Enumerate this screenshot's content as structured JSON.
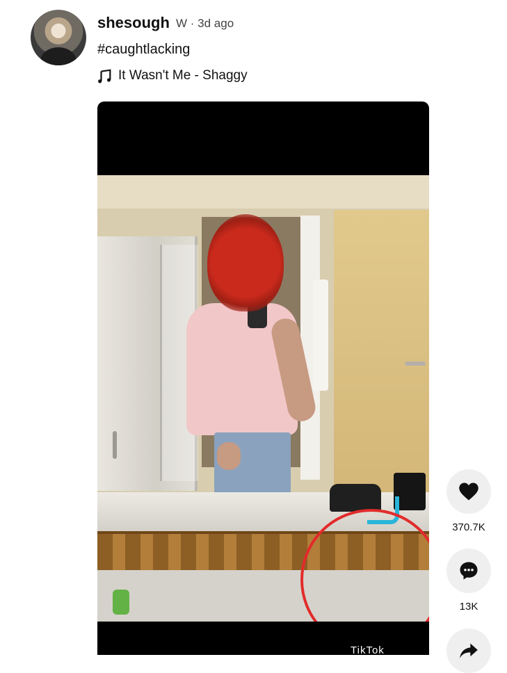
{
  "post": {
    "username": "shesough",
    "meta": "W · 3d ago",
    "caption": "#caughtlacking",
    "sound": "It Wasn't Me - Shaggy"
  },
  "video": {
    "watermark": "TikTok"
  },
  "actions": {
    "likes": "370.7K",
    "comments": "13K"
  },
  "colors": {
    "annotation_circle": "#e22b2b",
    "action_button_bg": "#efefef"
  },
  "icons": {
    "like": "heart-icon",
    "comment": "comment-icon",
    "share": "share-arrow-icon",
    "music": "music-note-icon"
  }
}
